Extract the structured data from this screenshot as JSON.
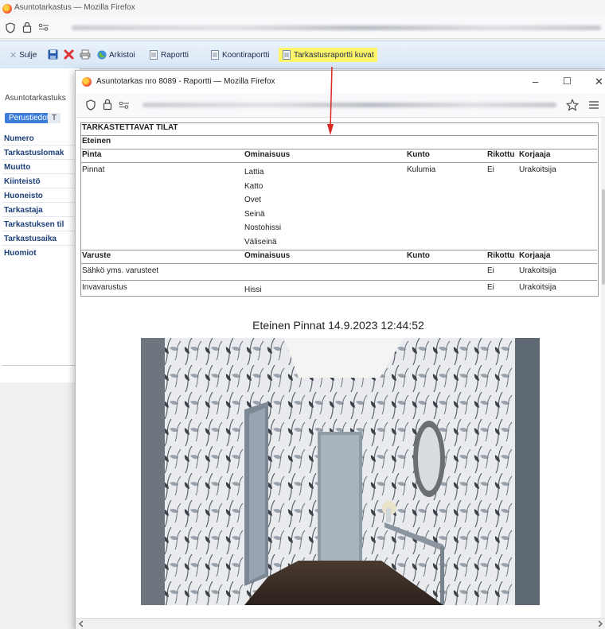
{
  "outer_window": {
    "title": "Asuntotarkastus — Mozilla Firefox"
  },
  "toolbar": {
    "close_label": "Sulje",
    "archive_label": "Arkistoi",
    "report_label": "Raportti",
    "account_report_label": "Koontiraportti",
    "photo_report_label": "Tarkastusraportti kuvat"
  },
  "app": {
    "header": "Asuntotarkastuks",
    "tab_basic": "Perustiedot",
    "tab_other": "T",
    "fields": [
      "Numero",
      "Tarkastuslomak",
      "Muutto",
      "Kiinteistö",
      "Huoneisto",
      "Tarkastaja",
      "Tarkastuksen til",
      "Tarkastusaika",
      "Huomiot"
    ]
  },
  "popup": {
    "title": "Asuntotarkas nro 8089 - Raportti — Mozilla Firefox",
    "minimize": "–",
    "maximize": "☐",
    "close": "✕"
  },
  "report": {
    "section_title": "TARKASTETTAVAT TILAT",
    "room": "Eteinen",
    "surfaces_headers": [
      "Pinta",
      "Ominaisuus",
      "Kunto",
      "Rikottu",
      "Korjaaja"
    ],
    "surface_name": "Pinnat",
    "surface_items": [
      "Lattia",
      "Katto",
      "Ovet",
      "Seinä",
      "Nostohissi",
      "Väliseinä"
    ],
    "surface_condition": "Kulumia",
    "surface_broken": "Ei",
    "surface_fixer": "Urakoitsija",
    "equipment_headers": [
      "Varuste",
      "Ominaisuus",
      "Kunto",
      "Rikottu",
      "Korjaaja"
    ],
    "equipment_rows": [
      {
        "name": "Sähkö yms. varusteet",
        "property": "",
        "condition": "",
        "broken": "Ei",
        "fixer": "Urakoitsija"
      },
      {
        "name": "Invavarustus",
        "property": "Hissi",
        "condition": "",
        "broken": "Ei",
        "fixer": "Urakoitsija"
      }
    ],
    "photo_caption": "Eteinen Pinnat 14.9.2023 12:44:52"
  },
  "colors": {
    "highlight": "#fff56a",
    "arrow": "#d8281f",
    "tab_active": "#3b7dd8"
  }
}
